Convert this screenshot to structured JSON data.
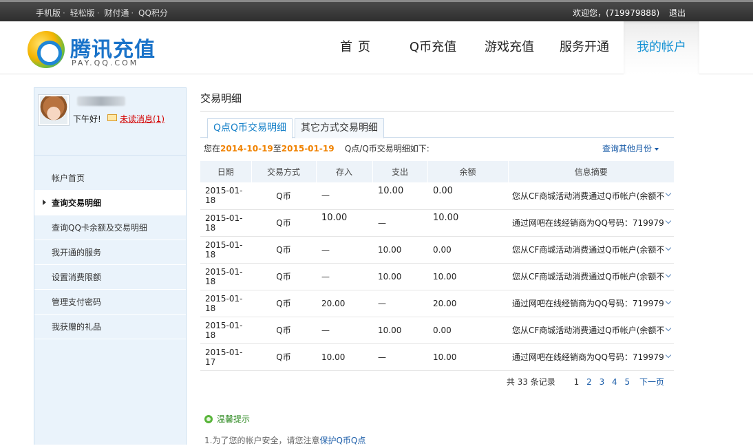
{
  "topbar": {
    "links": [
      "手机版",
      "轻松版",
      "财付通",
      "QQ积分"
    ],
    "welcome": "欢迎您，(719979888)",
    "logout": "退出"
  },
  "header": {
    "logo_title": "腾讯充值",
    "logo_sub": "PAY.QQ.COM",
    "nav": [
      "首页",
      "Q币充值",
      "游戏充值",
      "服务开通",
      "我的帐户"
    ],
    "active_nav": "我的帐户"
  },
  "sidebar": {
    "greeting": "下午好!",
    "unread": "未读消息(1)",
    "menu": [
      "帐户首页",
      "查询交易明细",
      "查询QQ卡余额及交易明细",
      "我开通的服务",
      "设置消费限额",
      "管理支付密码",
      "我获赠的礼品"
    ],
    "active_item": "查询交易明细"
  },
  "main": {
    "title": "交易明细",
    "tabs": [
      "Q点Q币交易明细",
      "其它方式交易明细"
    ],
    "summary": {
      "prefix": "您在",
      "from": "2014-10-19",
      "to_word": "至",
      "to": "2015-01-19",
      "suffix": "Q点/Q币交易明细如下:",
      "other_months": "查询其他月份"
    },
    "columns": [
      "日期",
      "交易方式",
      "存入",
      "支出",
      "余额",
      "信息摘要"
    ],
    "rows": [
      {
        "date": "2015-01-18",
        "method": "Q币",
        "in": "—",
        "out": "10.00",
        "balance": "0.00",
        "info": "您从CF商城活动消费通过Q币帐户(余额不",
        "shift": "out-bal"
      },
      {
        "date": "2015-01-18",
        "method": "Q币",
        "in": "10.00",
        "out": "—",
        "balance": "10.00",
        "info": "通过网吧在线经销商为QQ号码：719979",
        "shift": "in-bal"
      },
      {
        "date": "2015-01-18",
        "method": "Q币",
        "in": "—",
        "out": "10.00",
        "balance": "0.00",
        "info": "您从CF商城活动消费通过Q币帐户(余额不",
        "shift": ""
      },
      {
        "date": "2015-01-18",
        "method": "Q币",
        "in": "—",
        "out": "10.00",
        "balance": "10.00",
        "info": "您从CF商城活动消费通过Q币帐户(余额不",
        "shift": ""
      },
      {
        "date": "2015-01-18",
        "method": "Q币",
        "in": "20.00",
        "out": "—",
        "balance": "20.00",
        "info": "通过网吧在线经销商为QQ号码：719979",
        "shift": ""
      },
      {
        "date": "2015-01-18",
        "method": "Q币",
        "in": "—",
        "out": "10.00",
        "balance": "0.00",
        "info": "您从CF商城活动消费通过Q币帐户(余额不",
        "shift": ""
      },
      {
        "date": "2015-01-17",
        "method": "Q币",
        "in": "10.00",
        "out": "—",
        "balance": "10.00",
        "info": "通过网吧在线经销商为QQ号码：719979",
        "shift": ""
      }
    ],
    "pager": {
      "total": "共 33 条记录",
      "pages": [
        "1",
        "2",
        "3",
        "4",
        "5"
      ],
      "current": "1",
      "next": "下一页"
    }
  },
  "tips": {
    "heading": "温馨提示",
    "line1_text": "1.为了您的帐户安全，请您注意",
    "line1_link": "保护Q币Q点"
  }
}
